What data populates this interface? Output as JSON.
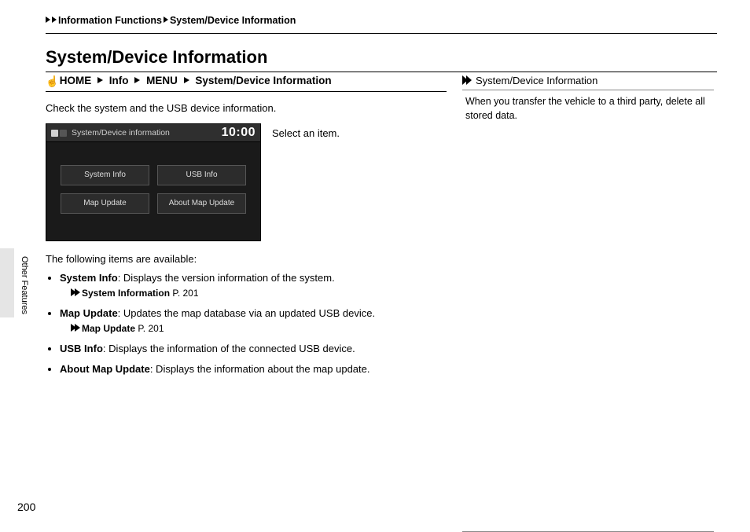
{
  "breadcrumb": {
    "a": "Information Functions",
    "b": "System/Device Information"
  },
  "heading": "System/Device Information",
  "nav": {
    "home": "HOME",
    "info": "Info",
    "menu": "MENU",
    "dest": "System/Device Information"
  },
  "intro": "Check the system and the USB device information.",
  "screenshot": {
    "title": "System/Device information",
    "clock": "10:00",
    "buttons": {
      "b1": "System Info",
      "b2": "USB Info",
      "b3": "Map Update",
      "b4": "About Map Update"
    }
  },
  "caption": "Select an item.",
  "follow": "The following items are available:",
  "items": {
    "i1": {
      "t": "System Info",
      "d": ": Displays the version information of the system.",
      "xref_t": "System Information",
      "xref_p": " P. 201"
    },
    "i2": {
      "t": "Map Update",
      "d": ": Updates the map database via an updated USB device.",
      "xref_t": "Map Update",
      "xref_p": " P. 201"
    },
    "i3": {
      "t": "USB Info",
      "d": ": Displays the information of the connected USB device."
    },
    "i4": {
      "t": "About Map Update",
      "d": ": Displays the information about the map update."
    }
  },
  "note": {
    "header": "System/Device Information",
    "body": "When you transfer the vehicle to a third party, delete all stored data."
  },
  "side_tab": "Other Features",
  "page_number": "200"
}
